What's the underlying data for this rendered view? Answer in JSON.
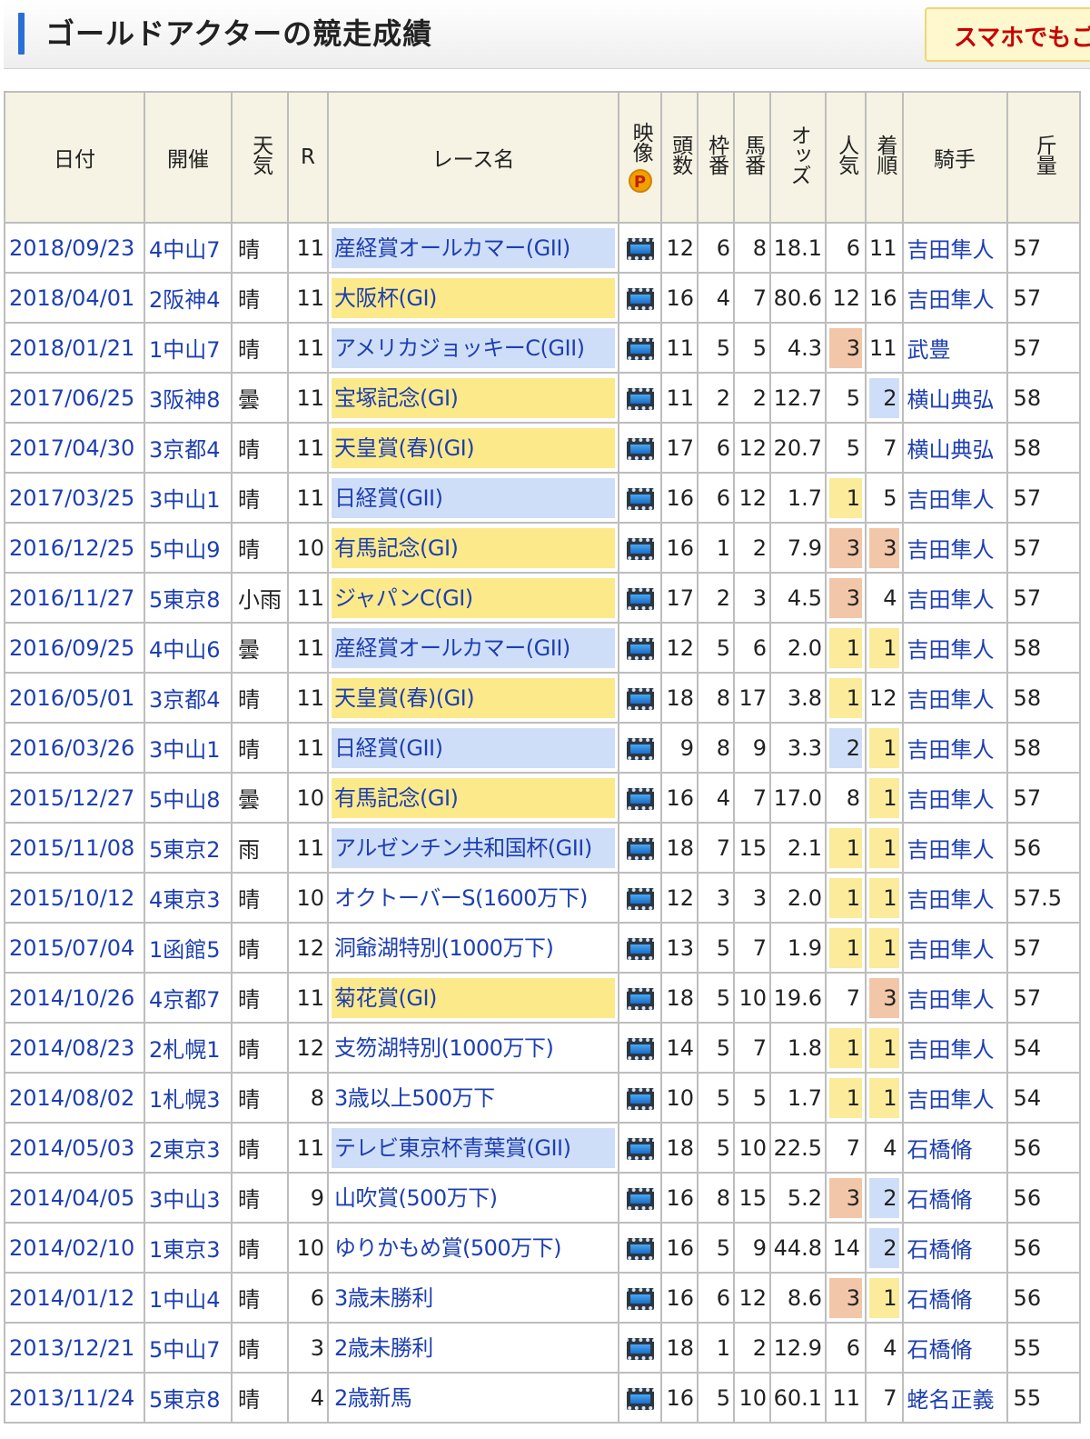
{
  "header": {
    "title": "ゴールドアクターの競走成績",
    "smartphone_label": "スマホでもご"
  },
  "columns": {
    "date": "日付",
    "meeting": "開催",
    "weather": "天気",
    "race_no": "R",
    "race_name": "レース名",
    "video": "映像",
    "video_badge": "P",
    "field_size": "頭数",
    "gate": "枠番",
    "horse_no": "馬番",
    "odds": "オッズ",
    "popularity": "人気",
    "finish": "着順",
    "jockey": "騎手",
    "weight": "斤量"
  },
  "icons": {
    "video": "film-icon",
    "premium": "p-badge-icon"
  },
  "colors": {
    "link": "#1d3fb0",
    "g1_background": "#fce98a",
    "g2_background": "#cfdef8",
    "rank1_background": "#fbeb9a",
    "rank2_background": "#cfdef8",
    "rank3_background": "#f2c6a8",
    "header_background": "#f6f3e4"
  },
  "rows": [
    {
      "date": "2018/09/23",
      "meeting": "4中山7",
      "weather": "晴",
      "race_no": "11",
      "race_name": "産経賞オールカマー(GII)",
      "grade": "g2",
      "field": "12",
      "gate": "6",
      "horse": "8",
      "odds": "18.1",
      "pop": "6",
      "finish": "11",
      "jockey": "吉田隼人",
      "weight": "57"
    },
    {
      "date": "2018/04/01",
      "meeting": "2阪神4",
      "weather": "晴",
      "race_no": "11",
      "race_name": "大阪杯(GI)",
      "grade": "g1",
      "field": "16",
      "gate": "4",
      "horse": "7",
      "odds": "80.6",
      "pop": "12",
      "finish": "16",
      "jockey": "吉田隼人",
      "weight": "57"
    },
    {
      "date": "2018/01/21",
      "meeting": "1中山7",
      "weather": "晴",
      "race_no": "11",
      "race_name": "アメリカジョッキーC(GII)",
      "grade": "g2",
      "field": "11",
      "gate": "5",
      "horse": "5",
      "odds": "4.3",
      "pop": "3",
      "finish": "11",
      "jockey": "武豊",
      "weight": "57"
    },
    {
      "date": "2017/06/25",
      "meeting": "3阪神8",
      "weather": "曇",
      "race_no": "11",
      "race_name": "宝塚記念(GI)",
      "grade": "g1",
      "field": "11",
      "gate": "2",
      "horse": "2",
      "odds": "12.7",
      "pop": "5",
      "finish": "2",
      "jockey": "横山典弘",
      "weight": "58"
    },
    {
      "date": "2017/04/30",
      "meeting": "3京都4",
      "weather": "晴",
      "race_no": "11",
      "race_name": "天皇賞(春)(GI)",
      "grade": "g1",
      "field": "17",
      "gate": "6",
      "horse": "12",
      "odds": "20.7",
      "pop": "5",
      "finish": "7",
      "jockey": "横山典弘",
      "weight": "58"
    },
    {
      "date": "2017/03/25",
      "meeting": "3中山1",
      "weather": "晴",
      "race_no": "11",
      "race_name": "日経賞(GII)",
      "grade": "g2",
      "field": "16",
      "gate": "6",
      "horse": "12",
      "odds": "1.7",
      "pop": "1",
      "finish": "5",
      "jockey": "吉田隼人",
      "weight": "57"
    },
    {
      "date": "2016/12/25",
      "meeting": "5中山9",
      "weather": "晴",
      "race_no": "10",
      "race_name": "有馬記念(GI)",
      "grade": "g1",
      "field": "16",
      "gate": "1",
      "horse": "2",
      "odds": "7.9",
      "pop": "3",
      "finish": "3",
      "jockey": "吉田隼人",
      "weight": "57"
    },
    {
      "date": "2016/11/27",
      "meeting": "5東京8",
      "weather": "小雨",
      "race_no": "11",
      "race_name": "ジャパンC(GI)",
      "grade": "g1",
      "field": "17",
      "gate": "2",
      "horse": "3",
      "odds": "4.5",
      "pop": "3",
      "finish": "4",
      "jockey": "吉田隼人",
      "weight": "57"
    },
    {
      "date": "2016/09/25",
      "meeting": "4中山6",
      "weather": "曇",
      "race_no": "11",
      "race_name": "産経賞オールカマー(GII)",
      "grade": "g2",
      "field": "12",
      "gate": "5",
      "horse": "6",
      "odds": "2.0",
      "pop": "1",
      "finish": "1",
      "jockey": "吉田隼人",
      "weight": "58"
    },
    {
      "date": "2016/05/01",
      "meeting": "3京都4",
      "weather": "晴",
      "race_no": "11",
      "race_name": "天皇賞(春)(GI)",
      "grade": "g1",
      "field": "18",
      "gate": "8",
      "horse": "17",
      "odds": "3.8",
      "pop": "1",
      "finish": "12",
      "jockey": "吉田隼人",
      "weight": "58"
    },
    {
      "date": "2016/03/26",
      "meeting": "3中山1",
      "weather": "晴",
      "race_no": "11",
      "race_name": "日経賞(GII)",
      "grade": "g2",
      "field": "9",
      "gate": "8",
      "horse": "9",
      "odds": "3.3",
      "pop": "2",
      "finish": "1",
      "jockey": "吉田隼人",
      "weight": "58"
    },
    {
      "date": "2015/12/27",
      "meeting": "5中山8",
      "weather": "曇",
      "race_no": "10",
      "race_name": "有馬記念(GI)",
      "grade": "g1",
      "field": "16",
      "gate": "4",
      "horse": "7",
      "odds": "17.0",
      "pop": "8",
      "finish": "1",
      "jockey": "吉田隼人",
      "weight": "57"
    },
    {
      "date": "2015/11/08",
      "meeting": "5東京2",
      "weather": "雨",
      "race_no": "11",
      "race_name": "アルゼンチン共和国杯(GII)",
      "grade": "g2",
      "field": "18",
      "gate": "7",
      "horse": "15",
      "odds": "2.1",
      "pop": "1",
      "finish": "1",
      "jockey": "吉田隼人",
      "weight": "56"
    },
    {
      "date": "2015/10/12",
      "meeting": "4東京3",
      "weather": "晴",
      "race_no": "10",
      "race_name": "オクトーバーS(1600万下)",
      "grade": "none",
      "field": "12",
      "gate": "3",
      "horse": "3",
      "odds": "2.0",
      "pop": "1",
      "finish": "1",
      "jockey": "吉田隼人",
      "weight": "57.5"
    },
    {
      "date": "2015/07/04",
      "meeting": "1函館5",
      "weather": "晴",
      "race_no": "12",
      "race_name": "洞爺湖特別(1000万下)",
      "grade": "none",
      "field": "13",
      "gate": "5",
      "horse": "7",
      "odds": "1.9",
      "pop": "1",
      "finish": "1",
      "jockey": "吉田隼人",
      "weight": "57"
    },
    {
      "date": "2014/10/26",
      "meeting": "4京都7",
      "weather": "晴",
      "race_no": "11",
      "race_name": "菊花賞(GI)",
      "grade": "g1",
      "field": "18",
      "gate": "5",
      "horse": "10",
      "odds": "19.6",
      "pop": "7",
      "finish": "3",
      "jockey": "吉田隼人",
      "weight": "57"
    },
    {
      "date": "2014/08/23",
      "meeting": "2札幌1",
      "weather": "晴",
      "race_no": "12",
      "race_name": "支笏湖特別(1000万下)",
      "grade": "none",
      "field": "14",
      "gate": "5",
      "horse": "7",
      "odds": "1.8",
      "pop": "1",
      "finish": "1",
      "jockey": "吉田隼人",
      "weight": "54"
    },
    {
      "date": "2014/08/02",
      "meeting": "1札幌3",
      "weather": "晴",
      "race_no": "8",
      "race_name": "3歳以上500万下",
      "grade": "none",
      "field": "10",
      "gate": "5",
      "horse": "5",
      "odds": "1.7",
      "pop": "1",
      "finish": "1",
      "jockey": "吉田隼人",
      "weight": "54"
    },
    {
      "date": "2014/05/03",
      "meeting": "2東京3",
      "weather": "晴",
      "race_no": "11",
      "race_name": "テレビ東京杯青葉賞(GII)",
      "grade": "g2",
      "field": "18",
      "gate": "5",
      "horse": "10",
      "odds": "22.5",
      "pop": "7",
      "finish": "4",
      "jockey": "石橋脩",
      "weight": "56"
    },
    {
      "date": "2014/04/05",
      "meeting": "3中山3",
      "weather": "晴",
      "race_no": "9",
      "race_name": "山吹賞(500万下)",
      "grade": "none",
      "field": "16",
      "gate": "8",
      "horse": "15",
      "odds": "5.2",
      "pop": "3",
      "finish": "2",
      "jockey": "石橋脩",
      "weight": "56"
    },
    {
      "date": "2014/02/10",
      "meeting": "1東京3",
      "weather": "晴",
      "race_no": "10",
      "race_name": "ゆりかもめ賞(500万下)",
      "grade": "none",
      "field": "16",
      "gate": "5",
      "horse": "9",
      "odds": "44.8",
      "pop": "14",
      "finish": "2",
      "jockey": "石橋脩",
      "weight": "56"
    },
    {
      "date": "2014/01/12",
      "meeting": "1中山4",
      "weather": "晴",
      "race_no": "6",
      "race_name": "3歳未勝利",
      "grade": "none",
      "field": "16",
      "gate": "6",
      "horse": "12",
      "odds": "8.6",
      "pop": "3",
      "finish": "1",
      "jockey": "石橋脩",
      "weight": "56"
    },
    {
      "date": "2013/12/21",
      "meeting": "5中山7",
      "weather": "晴",
      "race_no": "3",
      "race_name": "2歳未勝利",
      "grade": "none",
      "field": "18",
      "gate": "1",
      "horse": "2",
      "odds": "12.9",
      "pop": "6",
      "finish": "4",
      "jockey": "石橋脩",
      "weight": "55"
    },
    {
      "date": "2013/11/24",
      "meeting": "5東京8",
      "weather": "晴",
      "race_no": "4",
      "race_name": "2歳新馬",
      "grade": "none",
      "field": "16",
      "gate": "5",
      "horse": "10",
      "odds": "60.1",
      "pop": "11",
      "finish": "7",
      "jockey": "蛯名正義",
      "weight": "55"
    }
  ]
}
